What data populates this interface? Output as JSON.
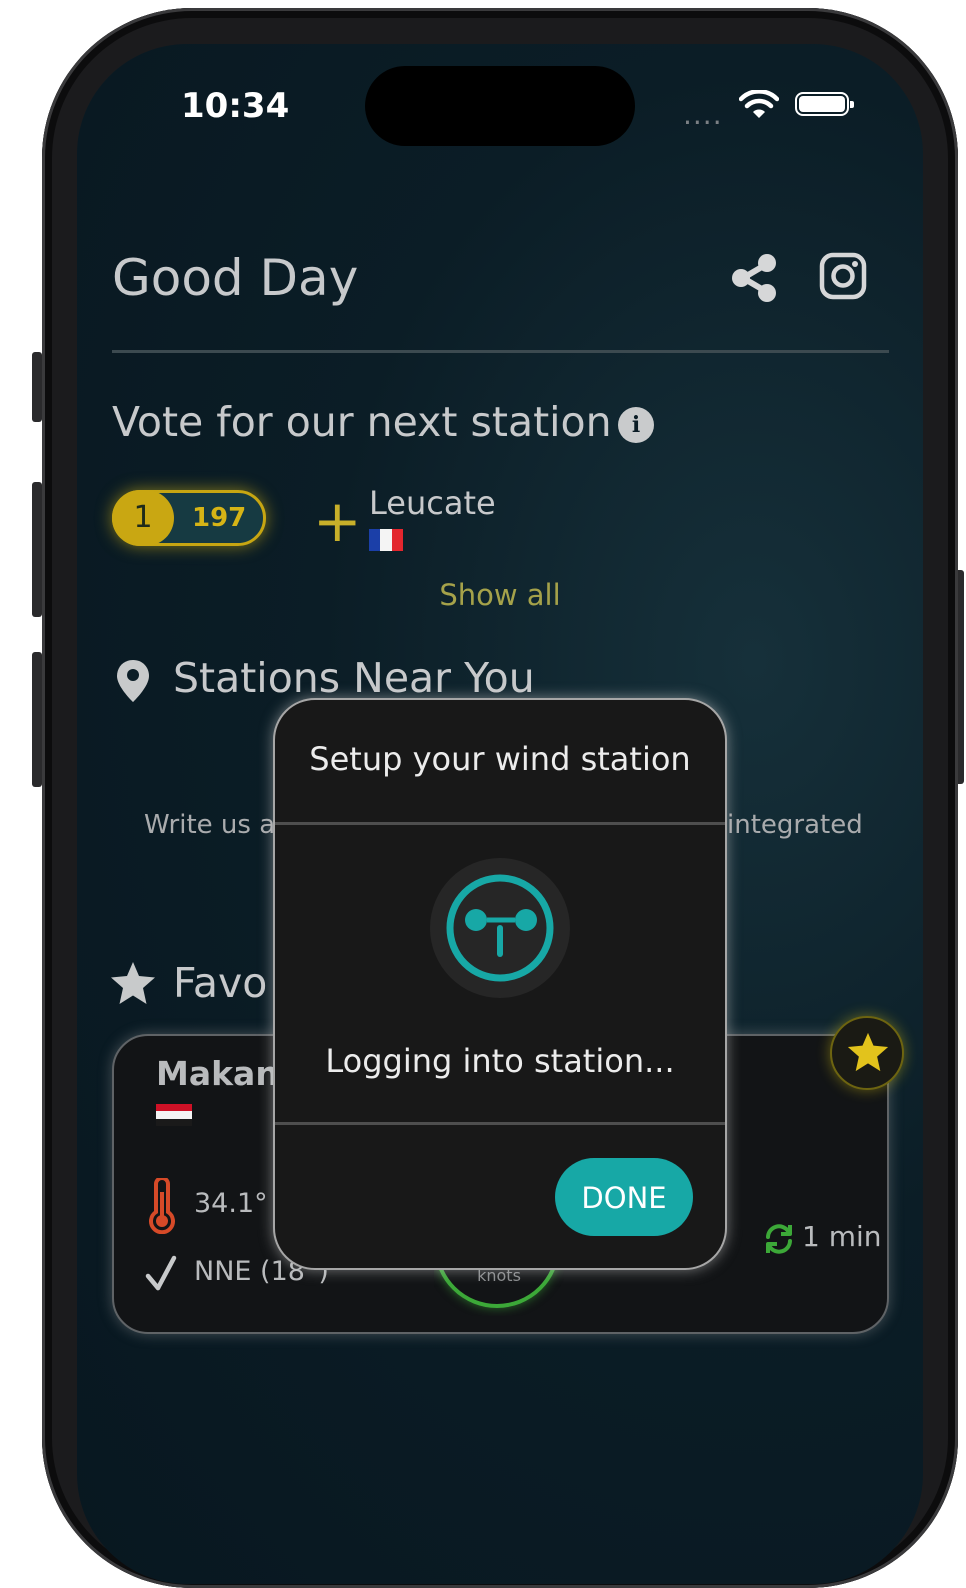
{
  "status_bar": {
    "time": "10:34",
    "signal": "...."
  },
  "header": {
    "title": "Good Day"
  },
  "vote": {
    "title": "Vote for our next station",
    "rank": "1",
    "count": "197",
    "candidate": {
      "name": "Leucate",
      "flag": "France"
    },
    "show_all": "Show all"
  },
  "near": {
    "title": "Stations Near You",
    "message_left": "Write us a",
    "message_right": "integrated"
  },
  "favorites": {
    "title": "Favo",
    "card": {
      "name": "Makani",
      "flag": "Egypt",
      "temperature": "34.1°",
      "direction": "NNE (18°)",
      "unit": "knots",
      "refresh": "1 min"
    }
  },
  "modal": {
    "title": "Setup your wind station",
    "status": "Logging into station...",
    "done_label": "DONE"
  },
  "colors": {
    "accent_teal": "#17a8a6",
    "gold": "#c9a712",
    "background": "#0b1d26",
    "gauge_green": "#3ca838"
  },
  "icons": [
    "share-icon",
    "instagram-icon",
    "info-icon",
    "plus-icon",
    "location-pin-icon",
    "star-icon",
    "thermometer-icon",
    "wind-direction-icon",
    "refresh-icon",
    "wind-station-icon",
    "wifi-icon",
    "battery-icon"
  ]
}
